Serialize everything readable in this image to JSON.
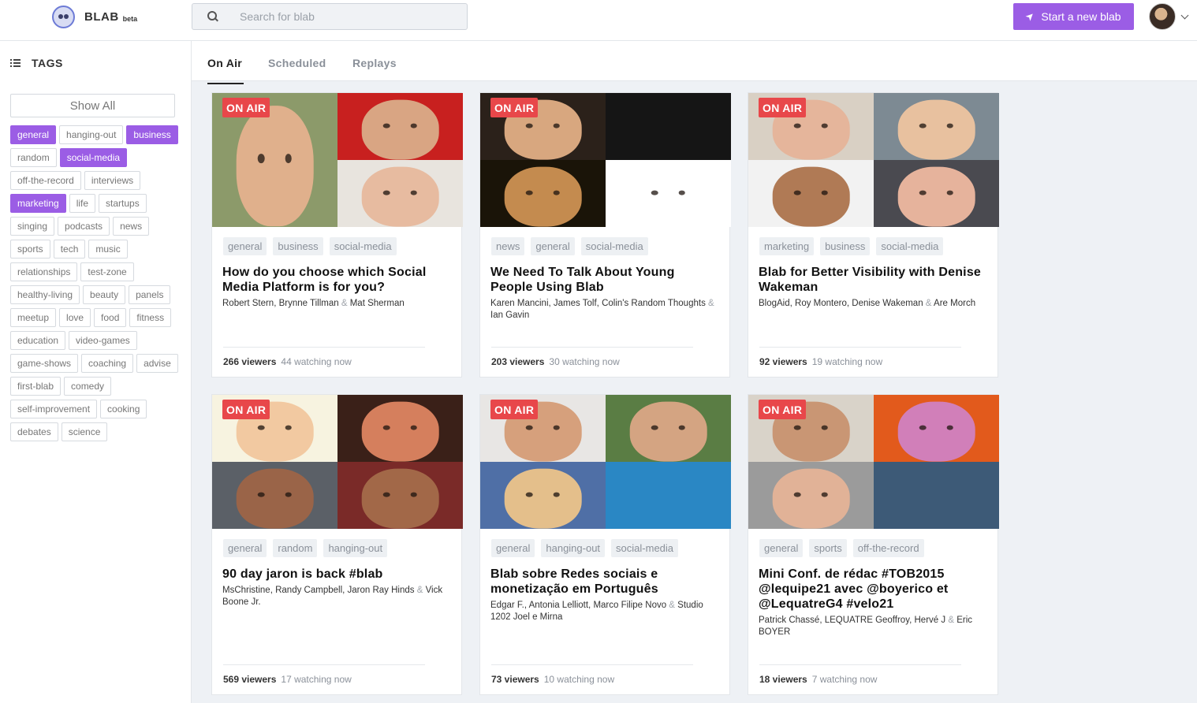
{
  "header": {
    "logo": "BLAB",
    "beta": "beta",
    "search_placeholder": "Search for blab",
    "start_button": "Start a new blab"
  },
  "sidebar": {
    "title": "TAGS",
    "show_all": "Show All",
    "tags": [
      {
        "label": "general",
        "active": true
      },
      {
        "label": "hanging-out",
        "active": false
      },
      {
        "label": "business",
        "active": true
      },
      {
        "label": "random",
        "active": false
      },
      {
        "label": "social-media",
        "active": true
      },
      {
        "label": "off-the-record",
        "active": false
      },
      {
        "label": "interviews",
        "active": false
      },
      {
        "label": "marketing",
        "active": true
      },
      {
        "label": "life",
        "active": false
      },
      {
        "label": "startups",
        "active": false
      },
      {
        "label": "singing",
        "active": false
      },
      {
        "label": "podcasts",
        "active": false
      },
      {
        "label": "news",
        "active": false
      },
      {
        "label": "sports",
        "active": false
      },
      {
        "label": "tech",
        "active": false
      },
      {
        "label": "music",
        "active": false
      },
      {
        "label": "relationships",
        "active": false
      },
      {
        "label": "test-zone",
        "active": false
      },
      {
        "label": "healthy-living",
        "active": false
      },
      {
        "label": "beauty",
        "active": false
      },
      {
        "label": "panels",
        "active": false
      },
      {
        "label": "meetup",
        "active": false
      },
      {
        "label": "love",
        "active": false
      },
      {
        "label": "food",
        "active": false
      },
      {
        "label": "fitness",
        "active": false
      },
      {
        "label": "education",
        "active": false
      },
      {
        "label": "video-games",
        "active": false
      },
      {
        "label": "game-shows",
        "active": false
      },
      {
        "label": "coaching",
        "active": false
      },
      {
        "label": "advise",
        "active": false
      },
      {
        "label": "first-blab",
        "active": false
      },
      {
        "label": "comedy",
        "active": false
      },
      {
        "label": "self-improvement",
        "active": false
      },
      {
        "label": "cooking",
        "active": false
      },
      {
        "label": "debates",
        "active": false
      },
      {
        "label": "science",
        "active": false
      }
    ]
  },
  "tabs": [
    {
      "label": "On Air",
      "active": true
    },
    {
      "label": "Scheduled",
      "active": false
    },
    {
      "label": "Replays",
      "active": false
    }
  ],
  "colors": {
    "accent": "#9b5de5",
    "on_air": "#e8474a"
  },
  "cards": [
    {
      "badge": "ON AIR",
      "tags": [
        "general",
        "business",
        "social-media"
      ],
      "title": "How do you choose which Social Media Platform is for you?",
      "hosts": [
        "Robert Stern",
        "Brynne Tillman"
      ],
      "last_host": "Mat Sherman",
      "viewers": "266 viewers",
      "watching": "44 watching now"
    },
    {
      "badge": "ON AIR",
      "tags": [
        "news",
        "general",
        "social-media"
      ],
      "title": "We Need To Talk About Young People Using Blab",
      "hosts": [
        "Karen Mancini",
        "James Tolf",
        "Colin's Random Thoughts"
      ],
      "last_host": "Ian Gavin",
      "viewers": "203 viewers",
      "watching": "30 watching now"
    },
    {
      "badge": "ON AIR",
      "tags": [
        "marketing",
        "business",
        "social-media"
      ],
      "title": "Blab for Better Visibility with Denise Wakeman",
      "hosts": [
        "BlogAid",
        "Roy Montero",
        "Denise Wakeman"
      ],
      "last_host": "Are Morch",
      "viewers": "92 viewers",
      "watching": "19 watching now"
    },
    {
      "badge": "ON AIR",
      "tags": [
        "general",
        "random",
        "hanging-out"
      ],
      "title": "90 day jaron is back #blab",
      "hosts": [
        "MsChristine",
        "Randy Campbell",
        "Jaron Ray Hinds"
      ],
      "last_host": "Vick Boone Jr.",
      "viewers": "569 viewers",
      "watching": "17 watching now"
    },
    {
      "badge": "ON AIR",
      "tags": [
        "general",
        "hanging-out",
        "social-media"
      ],
      "title": "Blab sobre Redes sociais e monetização em Português",
      "hosts": [
        "Edgar F.",
        "Antonia Lelliott",
        "Marco Filipe Novo"
      ],
      "last_host": "Studio 1202 Joel e Mirna",
      "viewers": "73 viewers",
      "watching": "10 watching now"
    },
    {
      "badge": "ON AIR",
      "tags": [
        "general",
        "sports",
        "off-the-record"
      ],
      "title": "Mini Conf. de rédac #TOB2015 @lequipe21 avec @boyerico et @LequatreG4 #velo21",
      "hosts": [
        "Patrick Chassé",
        "LEQUATRE Geoffroy",
        "Hervé J"
      ],
      "last_host": "Eric BOYER",
      "viewers": "18 viewers",
      "watching": "7 watching now"
    }
  ]
}
